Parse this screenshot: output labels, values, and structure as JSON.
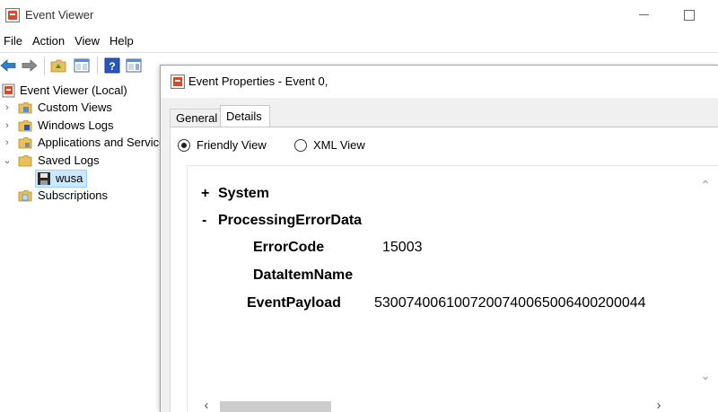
{
  "window": {
    "title": "Event Viewer"
  },
  "menu": [
    "File",
    "Action",
    "View",
    "Help"
  ],
  "toolbar": {
    "icons": [
      "back-arrow-icon",
      "forward-arrow-icon",
      "folder-up-icon",
      "show-pane-icon",
      "help-icon",
      "action-pane-icon"
    ]
  },
  "tree": {
    "root": "Event Viewer (Local)",
    "items": [
      {
        "label": "Custom Views",
        "icon": "folder-icon"
      },
      {
        "label": "Windows Logs",
        "icon": "folder-icon"
      },
      {
        "label": "Applications and Services Logs",
        "icon": "folder-icon"
      },
      {
        "label": "Saved Logs",
        "icon": "folder-icon"
      },
      {
        "label": "wusa",
        "icon": "disk-icon"
      },
      {
        "label": "Subscriptions",
        "icon": "folder-icon"
      }
    ]
  },
  "dialog": {
    "title": "Event Properties - Event 0,",
    "tabs": [
      "General",
      "Details"
    ],
    "active_tab": "Details",
    "view_options": {
      "friendly": "Friendly View",
      "xml": "XML View",
      "selected": "Friendly View"
    },
    "details": {
      "system_toggle": "+",
      "system_label": "System",
      "processing_toggle": "-",
      "processing_label": "ProcessingErrorData",
      "error_code_label": "ErrorCode",
      "error_code_value": "15003",
      "data_item_label": "DataItemName",
      "data_item_value": "",
      "payload_label": "EventPayload",
      "payload_value": "5300740061007200740065006400200044"
    }
  }
}
